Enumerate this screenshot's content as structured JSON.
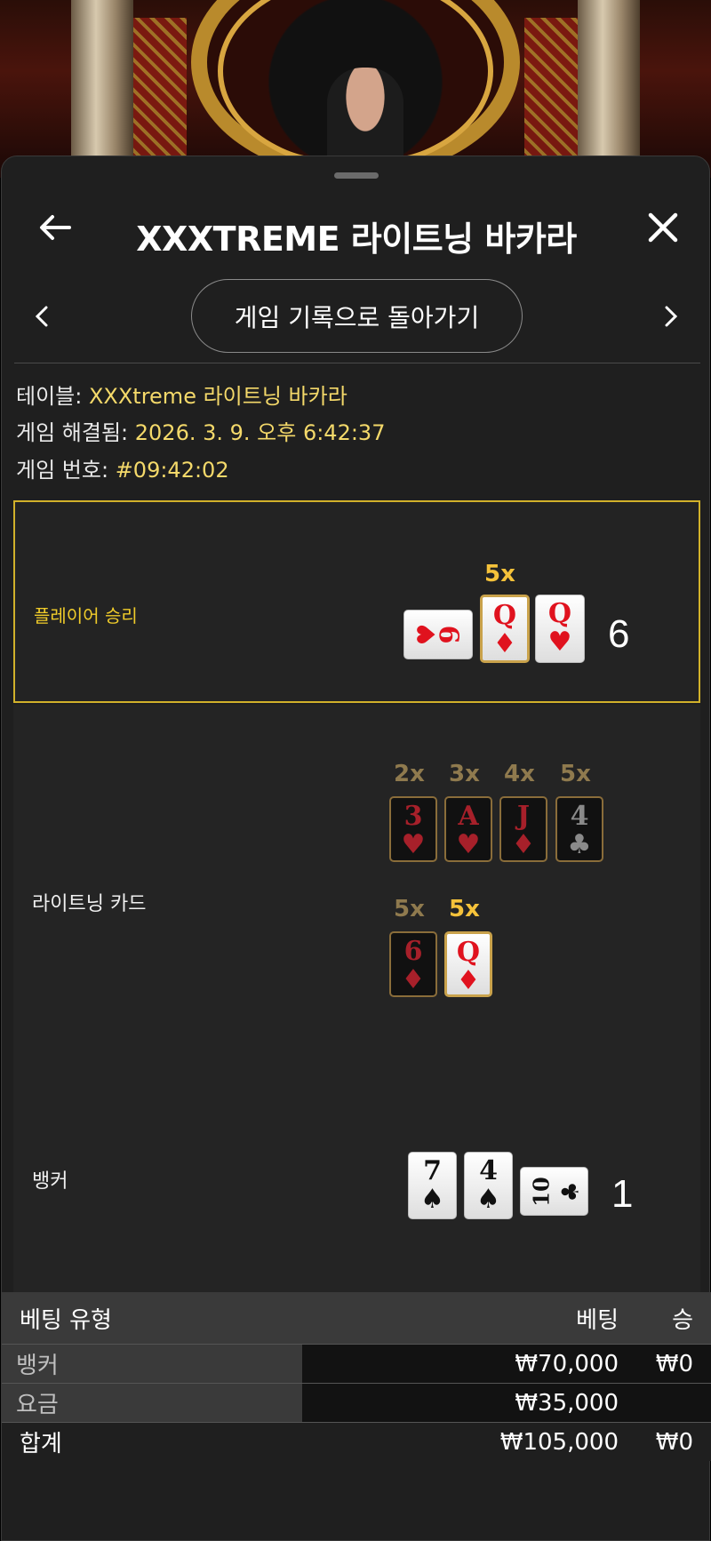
{
  "header": {
    "title": "XXXTREME 라이트닝 바카라"
  },
  "nav": {
    "return_label": "게임 기록으로 돌아가기"
  },
  "info": {
    "table_label": "테이블:",
    "table_value": "XXXtreme 라이트닝 바카라",
    "resolved_label": "게임 해결됨:",
    "resolved_value": "2026. 3. 9. 오후 6:42:37",
    "game_no_label": "게임 번호:",
    "game_no_value": "#09:42:02"
  },
  "player": {
    "label": "플레이어 승리",
    "score": "6",
    "cards": [
      {
        "rank": "9",
        "suit": "♥",
        "orientation": "sideways"
      },
      {
        "rank": "Q",
        "suit": "♦",
        "multiplier": "5x"
      },
      {
        "rank": "Q",
        "suit": "♥"
      }
    ]
  },
  "lightning": {
    "label": "라이트닝 카드",
    "cards": [
      {
        "rank": "3",
        "suit": "♥",
        "multiplier": "2x"
      },
      {
        "rank": "A",
        "suit": "♥",
        "multiplier": "3x"
      },
      {
        "rank": "J",
        "suit": "♦",
        "multiplier": "4x"
      },
      {
        "rank": "4",
        "suit": "♣",
        "multiplier": "5x"
      },
      {
        "rank": "6",
        "suit": "♦",
        "multiplier": "5x"
      },
      {
        "rank": "Q",
        "suit": "♦",
        "multiplier": "5x"
      }
    ]
  },
  "banker": {
    "label": "뱅커",
    "score": "1",
    "cards": [
      {
        "rank": "7",
        "suit": "♠"
      },
      {
        "rank": "4",
        "suit": "♠"
      },
      {
        "rank": "10",
        "suit": "♣",
        "orientation": "sideways"
      }
    ]
  },
  "bets": {
    "headers": {
      "type": "베팅 유형",
      "bet": "베팅",
      "win": "승"
    },
    "rows": [
      {
        "type": "뱅커",
        "bet": "₩70,000",
        "win": "₩0"
      },
      {
        "type": "요금",
        "bet": "₩35,000",
        "win": ""
      }
    ],
    "total": {
      "type": "합계",
      "bet": "₩105,000",
      "win": "₩0"
    }
  },
  "colors": {
    "accent_gold": "#f0cc2a",
    "value_yellow": "#f4d96a",
    "sheet_bg": "#1f1f1f"
  }
}
